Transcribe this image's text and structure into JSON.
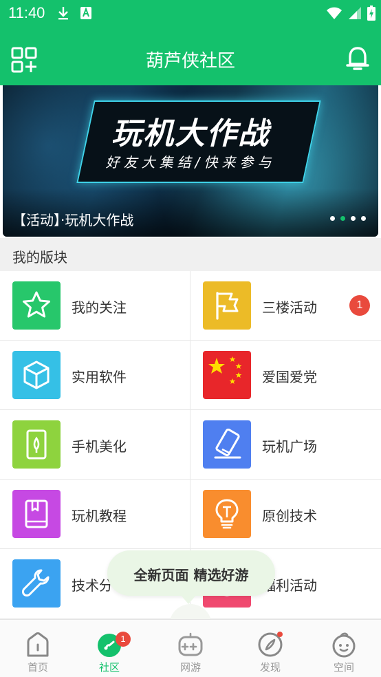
{
  "status_bar": {
    "time": "11:40",
    "left_icons": [
      "download-icon",
      "font-a-icon"
    ],
    "right_icons": [
      "wifi-icon",
      "signal-icon",
      "battery-charging-icon"
    ]
  },
  "header": {
    "title": "葫芦侠社区",
    "left_icon": "grid-add-icon",
    "right_icon": "bell-icon"
  },
  "banner": {
    "headline": "玩机大作战",
    "subline": "好友大集结/快来参与",
    "caption": "【活动】·玩机大作战",
    "slide_count": 4,
    "active_slide": 2
  },
  "section": {
    "title": "我的版块"
  },
  "boards": [
    {
      "label": "我的关注",
      "icon": "star-icon",
      "color": "#27c76b",
      "badge": ""
    },
    {
      "label": "三楼活动",
      "icon": "flag-icon",
      "color": "#ecbb27",
      "badge": "1"
    },
    {
      "label": "实用软件",
      "icon": "cube-icon",
      "color": "#35c0e6",
      "badge": ""
    },
    {
      "label": "爱国爱党",
      "icon": "china-flag-icon",
      "color": "#e8262a",
      "badge": ""
    },
    {
      "label": "手机美化",
      "icon": "phone-theme-icon",
      "color": "#8ed33e",
      "badge": ""
    },
    {
      "label": "玩机广场",
      "icon": "phone-tilt-icon",
      "color": "#4f7ff0",
      "badge": ""
    },
    {
      "label": "玩机教程",
      "icon": "book-icon",
      "color": "#c649e3",
      "badge": ""
    },
    {
      "label": "原创技术",
      "icon": "bulb-icon",
      "color": "#f98d2e",
      "badge": ""
    },
    {
      "label": "技术分",
      "icon": "wrench-icon",
      "color": "#3ba3f1",
      "badge": ""
    },
    {
      "label": "福利活动",
      "icon": "gift-icon",
      "color": "#f0496f",
      "badge": ""
    }
  ],
  "tooltip": {
    "text": "全新页面  精选好游"
  },
  "bottom_nav": {
    "items": [
      {
        "label": "首页",
        "icon": "home-icon",
        "active": false
      },
      {
        "label": "社区",
        "icon": "community-icon",
        "active": true
      },
      {
        "label": "网游",
        "icon": "gamepad-icon",
        "active": false
      },
      {
        "label": "发现",
        "icon": "compass-icon",
        "active": false
      },
      {
        "label": "空间",
        "icon": "face-icon",
        "active": false
      }
    ],
    "community_badge": "1"
  },
  "colors": {
    "brand": "#14c16c",
    "badge": "#e94a3d"
  }
}
